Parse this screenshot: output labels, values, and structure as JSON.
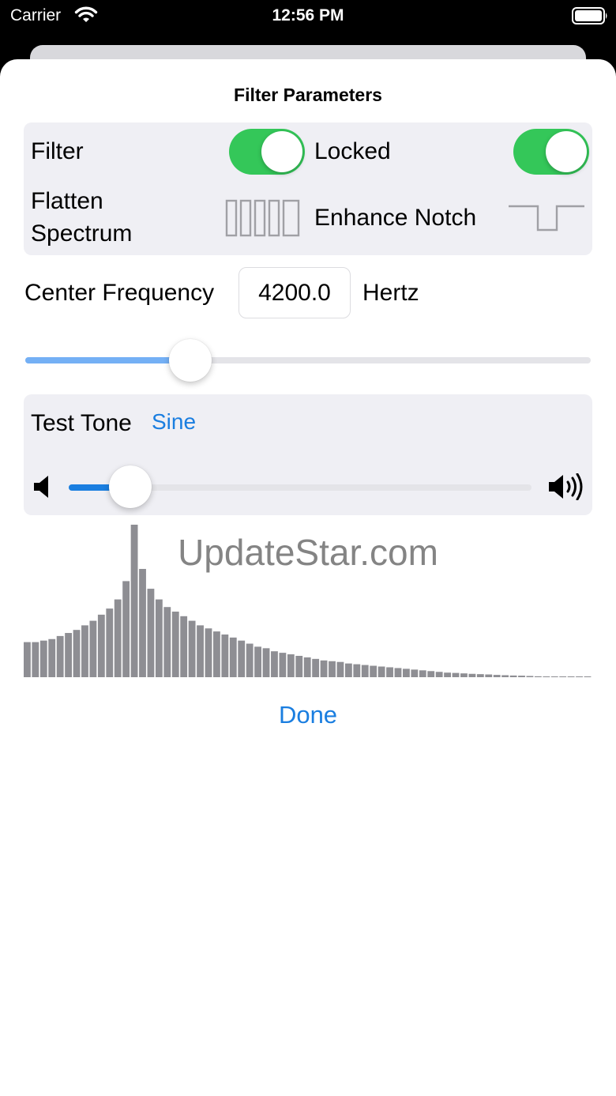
{
  "status_bar": {
    "carrier": "Carrier",
    "time": "12:56 PM",
    "icons": [
      "wifi-icon",
      "battery-icon"
    ]
  },
  "sheet": {
    "title": "Filter Parameters"
  },
  "filter_group": {
    "filter_label": "Filter",
    "filter_on": true,
    "locked_label": "Locked",
    "locked_on": true,
    "flatten_label_line1": "Flatten",
    "flatten_label_line2": "Spectrum",
    "flatten_icon": "flatten-spectrum-icon",
    "notch_label": "Enhance Notch",
    "notch_icon": "notch-icon"
  },
  "center_frequency": {
    "label": "Center Frequency",
    "value": "4200.0",
    "unit": "Hertz",
    "slider_fraction": 0.29
  },
  "test_tone": {
    "label": "Test Tone",
    "waveform": "Sine",
    "volume_fraction": 0.13,
    "icons": [
      "volume-min-icon",
      "volume-max-icon"
    ]
  },
  "spectrum": {
    "bar_levels": [
      0.23,
      0.23,
      0.24,
      0.25,
      0.27,
      0.29,
      0.31,
      0.34,
      0.37,
      0.41,
      0.45,
      0.51,
      0.63,
      1.0,
      0.71,
      0.58,
      0.51,
      0.46,
      0.43,
      0.4,
      0.37,
      0.34,
      0.32,
      0.3,
      0.28,
      0.26,
      0.24,
      0.22,
      0.2,
      0.19,
      0.17,
      0.16,
      0.15,
      0.14,
      0.13,
      0.12,
      0.11,
      0.105,
      0.1,
      0.09,
      0.085,
      0.08,
      0.075,
      0.07,
      0.065,
      0.06,
      0.055,
      0.05,
      0.045,
      0.04,
      0.035,
      0.03,
      0.028,
      0.025,
      0.022,
      0.02,
      0.018,
      0.015,
      0.013,
      0.011,
      0.01,
      0.008,
      0.006,
      0.005,
      0.004,
      0.003,
      0.002,
      0.001,
      0.001
    ],
    "bar_color": "#8e8e93"
  },
  "watermark": "UpdateStar.com",
  "done_label": "Done",
  "colors": {
    "accent": "#1a7ee0",
    "toggle_on": "#34c759",
    "group_bg": "#efeff4"
  }
}
